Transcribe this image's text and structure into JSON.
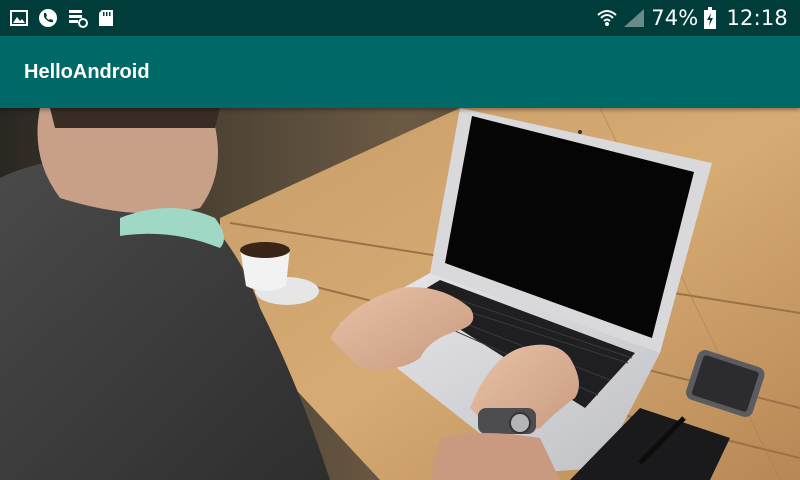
{
  "status_bar": {
    "icons_left": [
      "image-icon",
      "phone-icon",
      "sync-icon",
      "sd-card-icon"
    ],
    "icons_right": [
      "wifi-icon",
      "signal-icon"
    ],
    "battery_text": "74%",
    "battery_icon": "battery-charging-icon",
    "time": "12:18"
  },
  "app_bar": {
    "title": "HelloAndroid",
    "color": "#006866"
  },
  "status_bar_color": "#003d3a",
  "content": {
    "image_icon": "photo-person-laptop"
  }
}
